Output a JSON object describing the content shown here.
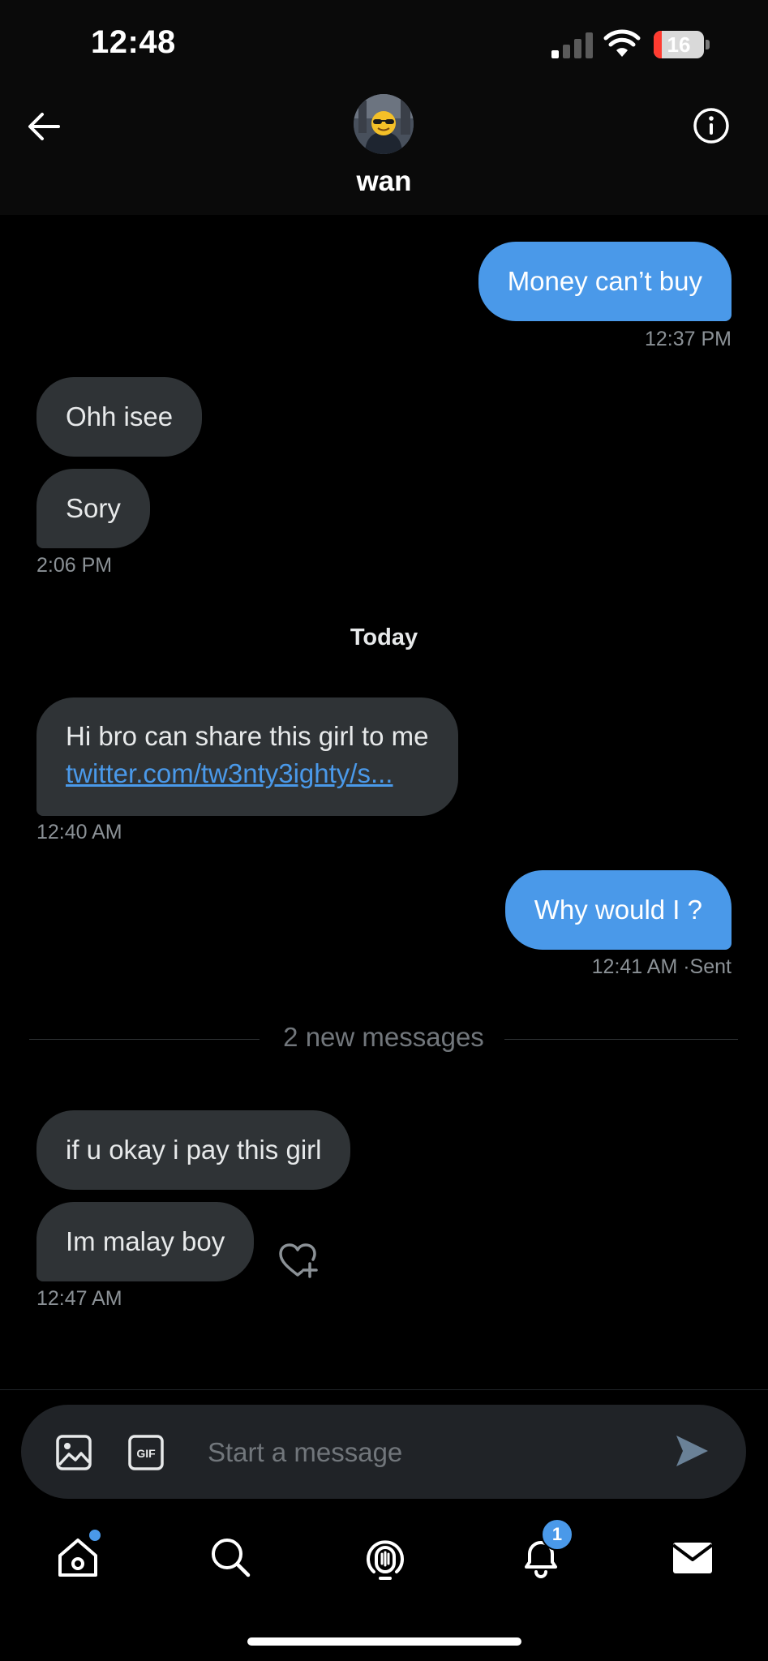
{
  "status_bar": {
    "time": "12:48",
    "battery": "16",
    "battery_level": 0.16
  },
  "header": {
    "name": "wan"
  },
  "messages": {
    "m1": {
      "text": "Money can’t buy",
      "time": "12:37 PM"
    },
    "m2": {
      "text": "Ohh isee"
    },
    "m3": {
      "text": "Sory",
      "time": "2:06 PM"
    },
    "day_label": "Today",
    "m4": {
      "text": "Hi bro can share this girl to me",
      "link": "twitter.com/tw3nty3ighty/s...",
      "time": "12:40 AM"
    },
    "m5": {
      "text": "Why would I ?",
      "time": "12:41 AM",
      "status": "·Sent"
    },
    "new_messages": "2 new messages",
    "m6": {
      "text": "if u okay i pay this girl"
    },
    "m7": {
      "text": "Im malay boy",
      "time": "12:47 AM"
    }
  },
  "composer": {
    "placeholder": "Start a message"
  },
  "nav": {
    "notifications_count": "1"
  },
  "colors": {
    "accent": "#4a99e9",
    "bubble_received": "#2f3336",
    "background": "#000000"
  }
}
